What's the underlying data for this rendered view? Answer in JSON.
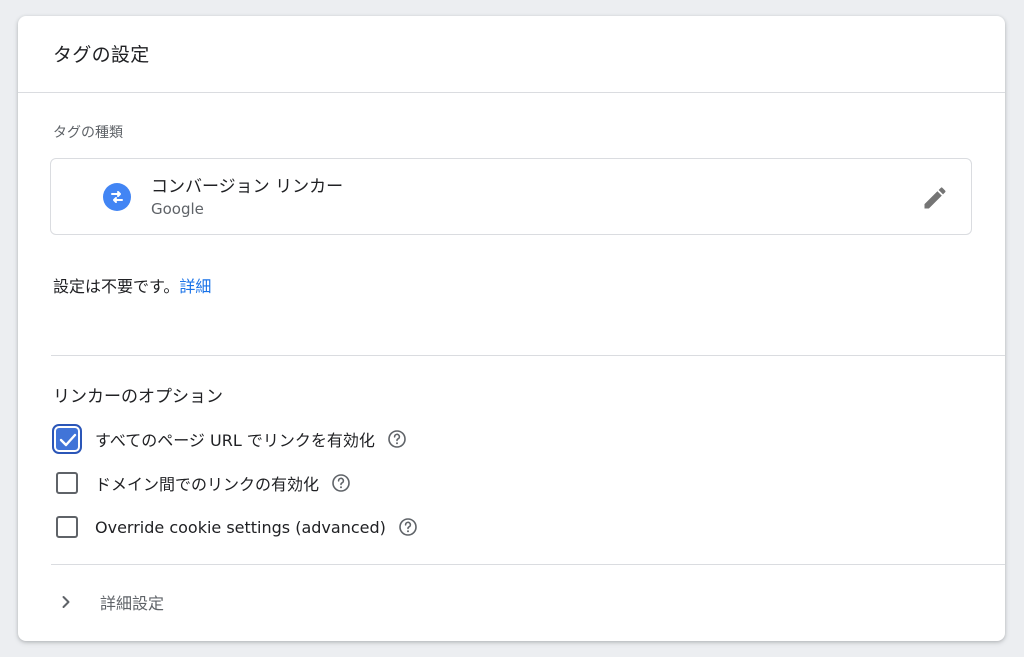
{
  "card": {
    "title": "タグの設定"
  },
  "tag_type": {
    "label": "タグの種類",
    "name": "コンバージョン リンカー",
    "vendor": "Google",
    "icon": "swap-arrows-icon",
    "icon_color": "#4285f4"
  },
  "config": {
    "text": "設定は不要です。",
    "link": "詳細",
    "link_color": "#1a73e8"
  },
  "linker_options": {
    "title": "リンカーのオプション",
    "items": [
      {
        "label": "すべてのページ URL でリンクを有効化",
        "checked": true
      },
      {
        "label": "ドメイン間でのリンクの有効化",
        "checked": false
      },
      {
        "label": "Override cookie settings (advanced)",
        "checked": false
      }
    ]
  },
  "advanced": {
    "label": "詳細設定",
    "icon": "chevron-right-icon"
  },
  "colors": {
    "accent": "#4174d8",
    "background": "#eceef1"
  }
}
